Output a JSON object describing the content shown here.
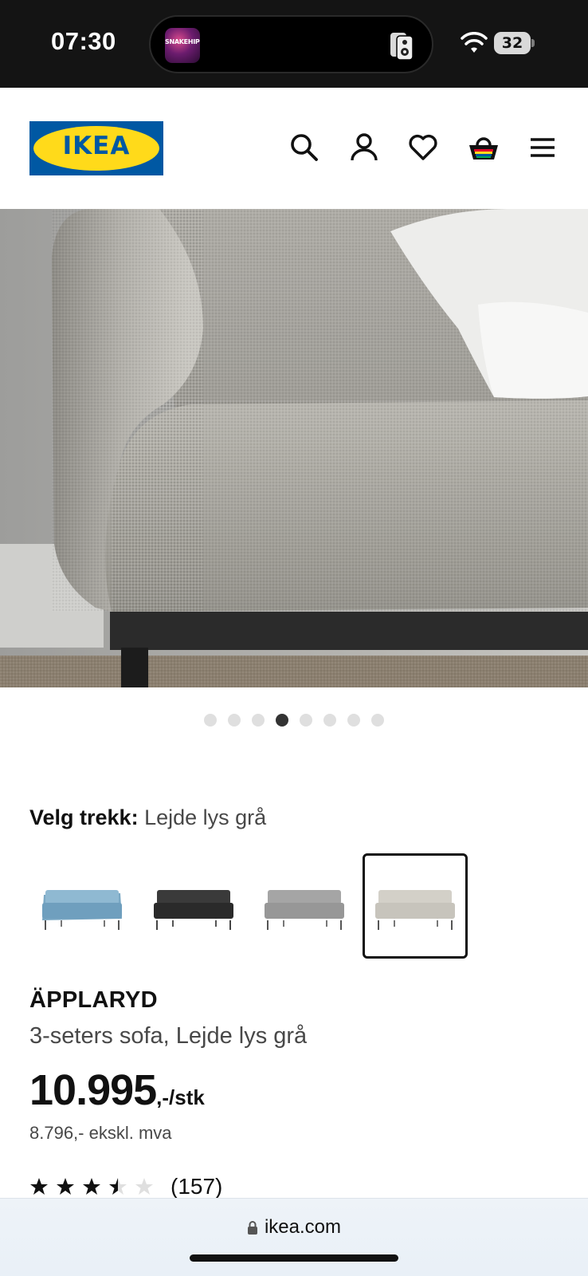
{
  "status_bar": {
    "time": "07:30",
    "now_playing_art_text": "SNAKEHIPS",
    "battery_level": "32"
  },
  "header": {
    "logo_text": "IKEA",
    "brand_colors": {
      "blue": "#0058a3",
      "yellow": "#ffda1a"
    },
    "icons": [
      "search-icon",
      "account-icon",
      "heart-icon",
      "cart-icon",
      "menu-icon"
    ]
  },
  "gallery": {
    "total_images": 8,
    "active_index": 4
  },
  "variant": {
    "label": "Velg trekk:",
    "selected_value": "Lejde lys grå",
    "swatches": [
      {
        "color": "light-blue",
        "selected": false
      },
      {
        "color": "black",
        "selected": false
      },
      {
        "color": "grey",
        "selected": false
      },
      {
        "color": "light-grey-beige",
        "selected": true
      }
    ]
  },
  "product": {
    "name": "ÄPPLARYD",
    "description": "3-seters sofa, Lejde lys grå",
    "price_main": "10.995",
    "price_suffix": ",-/stk",
    "price_excl_vat": "8.796,- ekskl. mva",
    "rating_stars": 3.5,
    "rating_count": "(157)"
  },
  "browser": {
    "url": "ikea.com"
  }
}
